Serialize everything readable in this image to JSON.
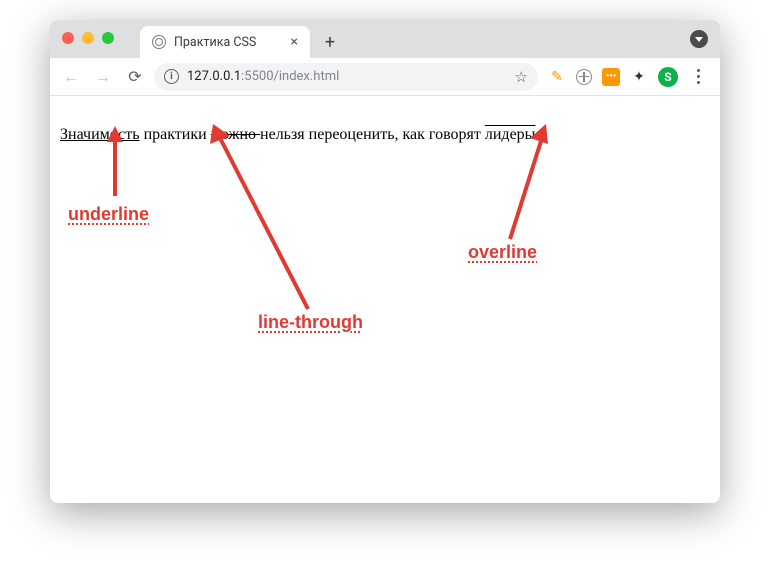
{
  "window": {
    "tab_title": "Практика CSS",
    "new_tab_symbol": "+"
  },
  "toolbar": {
    "url_host": "127.0.0.1",
    "url_port_path": ":5500/index.html",
    "star": "☆",
    "pencil": "✎",
    "orange_badge": "•••",
    "puzzle": "✦",
    "s_badge": "S"
  },
  "page": {
    "word_underline": "Значимость",
    "word_plain1": " практики ",
    "word_strike": "можно ",
    "word_plain2": "нельзя переоценить, как говорят ",
    "word_overline": "лидеры"
  },
  "annotations": {
    "underline": "underline",
    "line_through": "line-through",
    "overline": "overline"
  }
}
